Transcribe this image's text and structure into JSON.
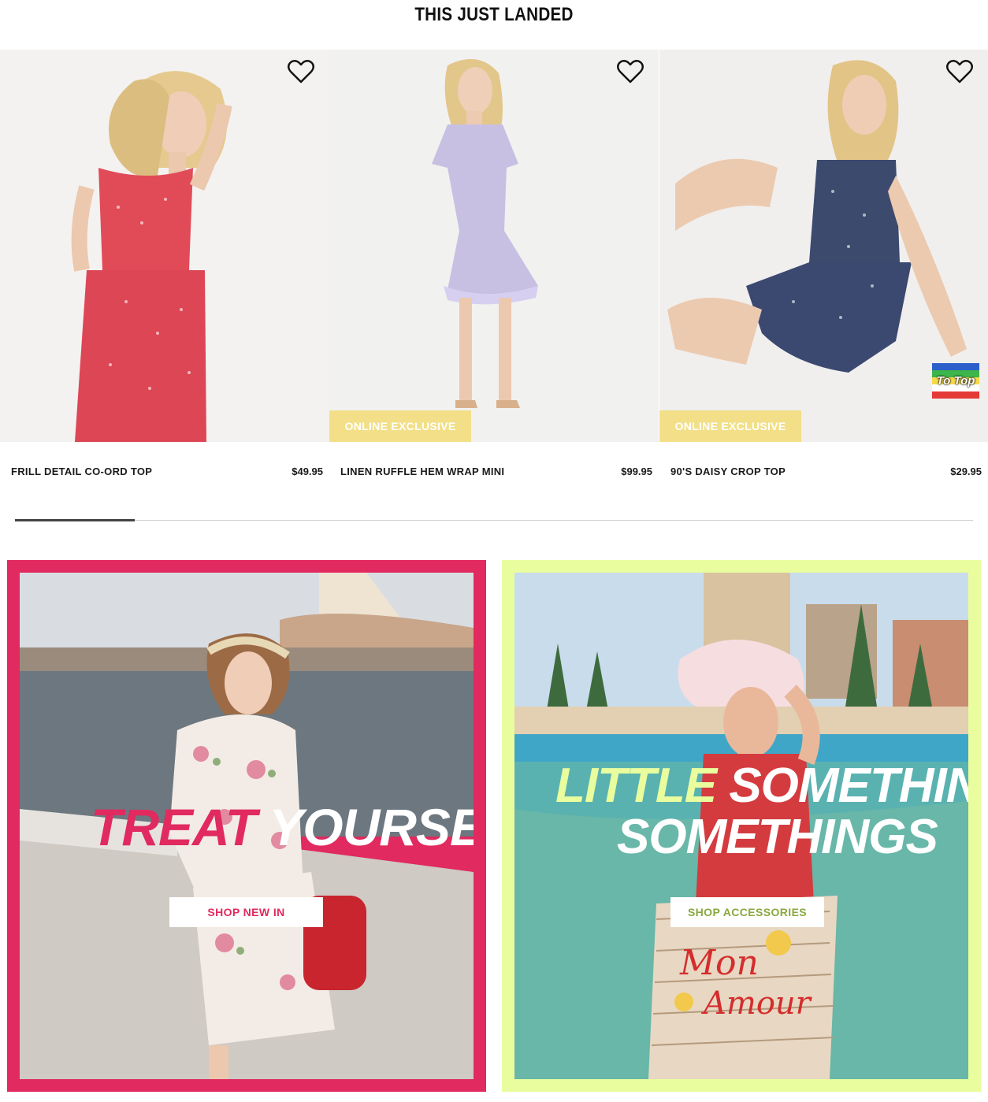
{
  "section": {
    "title": "THIS JUST LANDED"
  },
  "products": [
    {
      "name": "FRILL DETAIL CO-ORD TOP",
      "price": "$49.95",
      "badge": ""
    },
    {
      "name": "LINEN RUFFLE HEM WRAP MINI",
      "price": "$99.95",
      "badge": "ONLINE EXCLUSIVE"
    },
    {
      "name": "90'S DAISY CROP TOP",
      "price": "$29.95",
      "badge": "ONLINE EXCLUSIVE"
    }
  ],
  "carousel": {
    "progress_fraction": 0.125
  },
  "to_top": {
    "label": "To Top"
  },
  "promos": [
    {
      "headline_accent": "TREAT",
      "headline_rest": "YOURSELF",
      "cta": "SHOP NEW IN",
      "accent_color": "#e12a5f"
    },
    {
      "headline_accent": "LITTLE",
      "headline_rest": "SOMETHING,",
      "headline_line2": "SOMETHINGS",
      "cta": "SHOP ACCESSORIES",
      "accent_color": "#e9fd9e",
      "cta_color": "#8aa840"
    }
  ],
  "icons": {
    "favorite": "heart-outline-icon"
  }
}
